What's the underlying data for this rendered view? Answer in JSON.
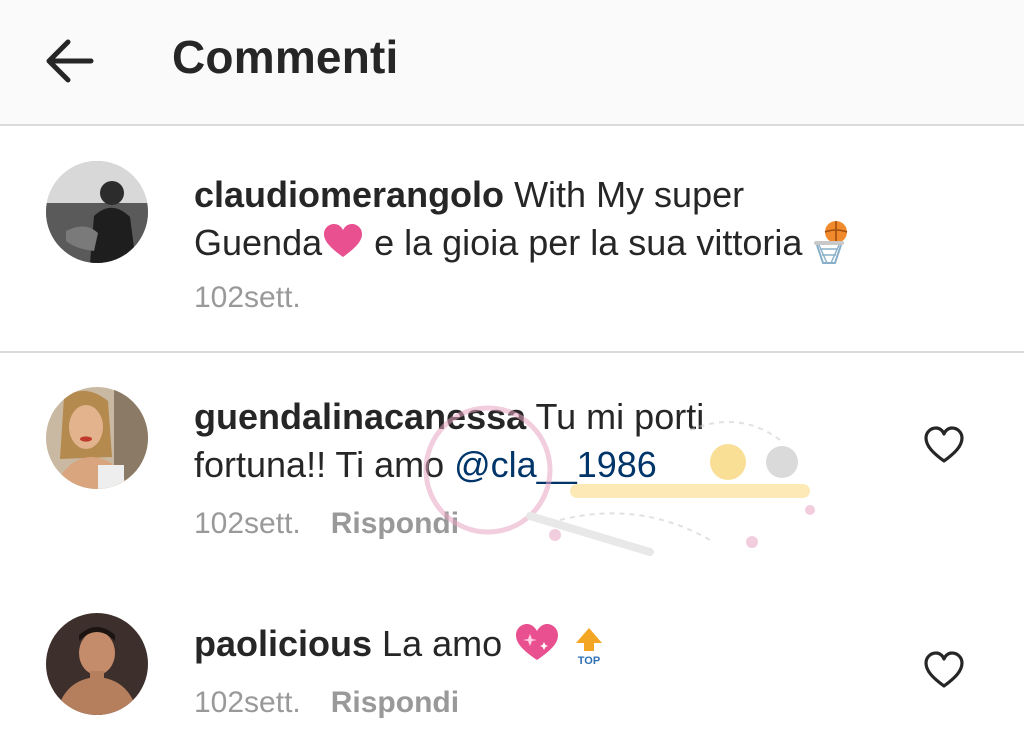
{
  "header": {
    "title": "Commenti",
    "back_icon": "arrow-left-icon"
  },
  "comments": [
    {
      "username": "claudiomerangolo",
      "text_a": "With My super",
      "text_b": "Guenda",
      "text_c": " e la gioia per la sua vittoria ",
      "time": "102sett.",
      "emojis": [
        "heart-icon",
        "basketball-hoop-icon"
      ]
    },
    {
      "username": "guendalinacanessa",
      "text_a": "Tu mi porti",
      "text_b": "fortuna!! Ti amo ",
      "mention": "@cla__1986",
      "time": "102sett.",
      "reply": "Rispondi",
      "like_icon": "heart-outline-icon"
    },
    {
      "username": "paolicious",
      "text_a": "La amo ",
      "time": "102sett.",
      "reply": "Rispondi",
      "like_icon": "heart-outline-icon",
      "emojis": [
        "sparkling-heart-icon",
        "top-arrow-icon"
      ],
      "top_label": "TOP"
    }
  ],
  "colors": {
    "header_bg": "#fafafa",
    "divider": "#dbdbdb",
    "text": "#262626",
    "meta": "#999999",
    "mention": "#003569",
    "emoji_heart": "#e8508f"
  }
}
